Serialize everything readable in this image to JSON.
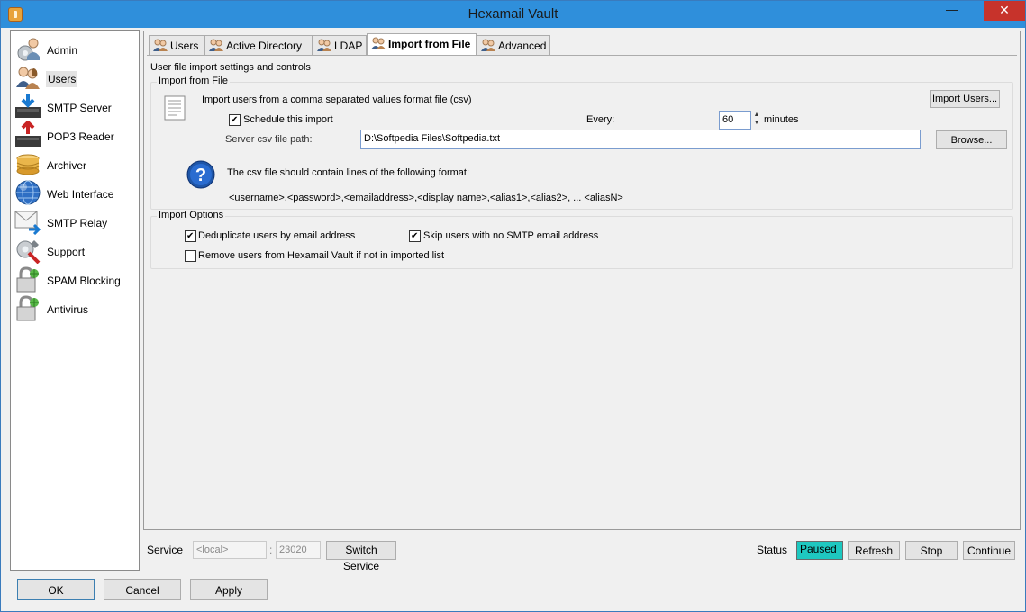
{
  "window": {
    "title": "Hexamail Vault"
  },
  "sidebar": {
    "items": [
      {
        "label": "Admin",
        "icon": "admin-icon"
      },
      {
        "label": "Users",
        "icon": "users-icon"
      },
      {
        "label": "SMTP Server",
        "icon": "smtp-server-icon"
      },
      {
        "label": "POP3 Reader",
        "icon": "pop3-reader-icon"
      },
      {
        "label": "Archiver",
        "icon": "archiver-icon"
      },
      {
        "label": "Web Interface",
        "icon": "globe-icon"
      },
      {
        "label": "SMTP Relay",
        "icon": "relay-icon"
      },
      {
        "label": "Support",
        "icon": "support-icon"
      },
      {
        "label": "SPAM Blocking",
        "icon": "lock-icon"
      },
      {
        "label": "Antivirus",
        "icon": "lock-icon"
      }
    ],
    "selected": "Users"
  },
  "tabs": [
    {
      "label": "Users"
    },
    {
      "label": "Active Directory"
    },
    {
      "label": "LDAP"
    },
    {
      "label": "Import from File"
    },
    {
      "label": "Advanced"
    }
  ],
  "active_tab": "Import from File",
  "content": {
    "caption": "User file import settings and controls",
    "import_group": {
      "title": "Import from File",
      "description": "Import users from a comma separated values format file (csv)",
      "import_button": "Import Users...",
      "schedule_label": "Schedule this import",
      "schedule_checked": true,
      "every_label": "Every:",
      "every_value": "60",
      "minutes_label": "minutes",
      "path_label": "Server csv file path:",
      "path_value": "D:\\Softpedia Files\\Softpedia.txt",
      "browse_button": "Browse...",
      "format_note": "The csv file should contain lines of the following format:",
      "format_example": "<username>,<password>,<emailaddress>,<display name>,<alias1>,<alias2>, ... <aliasN>"
    },
    "options_group": {
      "title": "Import Options",
      "dedupe_label": "Deduplicate users by email address",
      "dedupe_checked": true,
      "skip_label": "Skip users with no SMTP email address",
      "skip_checked": true,
      "remove_label": "Remove users from Hexamail Vault if not in imported list",
      "remove_checked": false
    }
  },
  "service_bar": {
    "service_label": "Service",
    "host_value": "<local>",
    "port_separator": ":",
    "port_value": "23020",
    "switch_button": "Switch Service",
    "status_label": "Status",
    "status_value": "Paused",
    "refresh_button": "Refresh",
    "stop_button": "Stop",
    "continue_button": "Continue"
  },
  "footer": {
    "ok_button": "OK",
    "cancel_button": "Cancel",
    "apply_button": "Apply"
  },
  "colors": {
    "titlebar": "#2f8fdb",
    "close": "#c7332b",
    "status_paused": "#1ec8c0"
  }
}
